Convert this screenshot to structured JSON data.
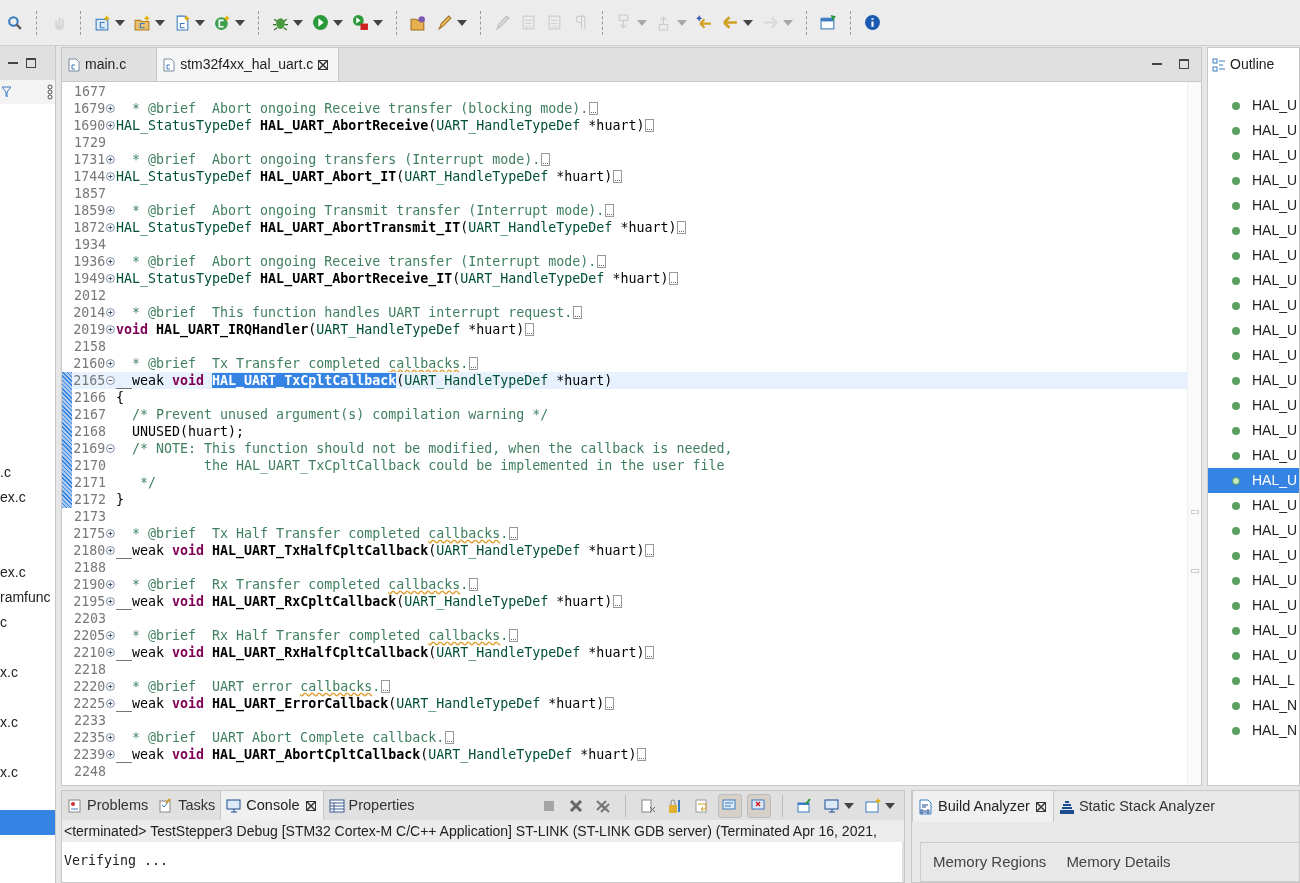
{
  "toolbar": [
    {
      "kind": "search",
      "disabled": false,
      "dropdown": false
    },
    {
      "kind": "separator"
    },
    {
      "kind": "hand",
      "disabled": true,
      "dropdown": false
    },
    {
      "kind": "separator"
    },
    {
      "kind": "new-project",
      "disabled": false,
      "dropdown": true
    },
    {
      "kind": "new-folder",
      "disabled": false,
      "dropdown": true
    },
    {
      "kind": "new-file",
      "disabled": false,
      "dropdown": true
    },
    {
      "kind": "new-class",
      "disabled": false,
      "dropdown": true
    },
    {
      "kind": "separator"
    },
    {
      "kind": "debug",
      "disabled": false,
      "dropdown": true
    },
    {
      "kind": "run",
      "disabled": false,
      "dropdown": true
    },
    {
      "kind": "external-tool",
      "disabled": false,
      "dropdown": true
    },
    {
      "kind": "separator"
    },
    {
      "kind": "open-folder",
      "disabled": false,
      "dropdown": false
    },
    {
      "kind": "pen",
      "disabled": false,
      "dropdown": true
    },
    {
      "kind": "separator"
    },
    {
      "kind": "pen",
      "disabled": true,
      "dropdown": false
    },
    {
      "kind": "document",
      "disabled": true,
      "dropdown": false
    },
    {
      "kind": "document",
      "disabled": true,
      "dropdown": false
    },
    {
      "kind": "pilcrow",
      "disabled": true,
      "dropdown": false
    },
    {
      "kind": "separator"
    },
    {
      "kind": "arrow-down",
      "disabled": true,
      "dropdown": true
    },
    {
      "kind": "arrow-up",
      "disabled": true,
      "dropdown": true
    },
    {
      "kind": "star-arrow",
      "disabled": false,
      "dropdown": false
    },
    {
      "kind": "arrow-left",
      "disabled": false,
      "dropdown": true
    },
    {
      "kind": "arrow-right",
      "disabled": true,
      "dropdown": true
    },
    {
      "kind": "separator"
    },
    {
      "kind": "window",
      "disabled": false,
      "dropdown": false
    },
    {
      "kind": "separator"
    },
    {
      "kind": "info",
      "disabled": false,
      "dropdown": false
    }
  ],
  "project_explorer": {
    "items": [
      {
        "label": ".c",
        "selected": false
      },
      {
        "label": "ex.c",
        "selected": false
      },
      {
        "selected": false
      },
      {
        "selected": false
      },
      {
        "label": "ex.c",
        "selected": false
      },
      {
        "label": "ramfunc",
        "selected": false
      },
      {
        "label": "c",
        "selected": false
      },
      {
        "selected": false
      },
      {
        "label": "x.c",
        "selected": false
      },
      {
        "selected": false
      },
      {
        "label": "x.c",
        "selected": false
      },
      {
        "selected": false
      },
      {
        "label": "x.c",
        "selected": false
      },
      {
        "selected": false
      },
      {
        "selected": true
      }
    ]
  },
  "editor": {
    "tabs": [
      {
        "label": "main.c",
        "selected": false
      },
      {
        "label": "stm32f4xx_hal_uart.c",
        "selected": true
      }
    ],
    "lines": [
      {
        "number": "1677",
        "changed": false,
        "current": false
      },
      {
        "number": "1679",
        "folded": true,
        "changed": false,
        "current": false,
        "tokens": [
          {
            "kind": "comment",
            "text": "  * @brief  Abort ongoing Receive transfer (blocking mode)."
          }
        ]
      },
      {
        "number": "1690",
        "folded": true,
        "changed": false,
        "current": false,
        "tokens": [
          {
            "kind": "type",
            "text": "HAL_StatusTypeDef "
          },
          {
            "kind": "function",
            "text": "HAL_UART_AbortReceive"
          },
          {
            "kind": "plain",
            "text": "("
          },
          {
            "kind": "type",
            "text": "UART_HandleTypeDef"
          },
          {
            "kind": "plain",
            "text": " *huart)"
          }
        ]
      },
      {
        "number": "1729",
        "changed": false,
        "current": false
      },
      {
        "number": "1731",
        "folded": true,
        "changed": false,
        "current": false,
        "tokens": [
          {
            "kind": "comment",
            "text": "  * @brief  Abort ongoing transfers (Interrupt mode)."
          }
        ]
      },
      {
        "number": "1744",
        "folded": true,
        "changed": false,
        "current": false,
        "tokens": [
          {
            "kind": "type",
            "text": "HAL_StatusTypeDef "
          },
          {
            "kind": "function",
            "text": "HAL_UART_Abort_IT"
          },
          {
            "kind": "plain",
            "text": "("
          },
          {
            "kind": "type",
            "text": "UART_HandleTypeDef"
          },
          {
            "kind": "plain",
            "text": " *huart)"
          }
        ]
      },
      {
        "number": "1857",
        "changed": false,
        "current": false
      },
      {
        "number": "1859",
        "folded": true,
        "changed": false,
        "current": false,
        "tokens": [
          {
            "kind": "comment",
            "text": "  * @brief  Abort ongoing Transmit transfer (Interrupt mode)."
          }
        ]
      },
      {
        "number": "1872",
        "folded": true,
        "changed": false,
        "current": false,
        "tokens": [
          {
            "kind": "type",
            "text": "HAL_StatusTypeDef "
          },
          {
            "kind": "function",
            "text": "HAL_UART_AbortTransmit_IT"
          },
          {
            "kind": "plain",
            "text": "("
          },
          {
            "kind": "type",
            "text": "UART_HandleTypeDef"
          },
          {
            "kind": "plain",
            "text": " *huart)"
          }
        ]
      },
      {
        "number": "1934",
        "changed": false,
        "current": false
      },
      {
        "number": "1936",
        "folded": true,
        "changed": false,
        "current": false,
        "tokens": [
          {
            "kind": "comment",
            "text": "  * @brief  Abort ongoing Receive transfer (Interrupt mode)."
          }
        ]
      },
      {
        "number": "1949",
        "folded": true,
        "changed": false,
        "current": false,
        "tokens": [
          {
            "kind": "type",
            "text": "HAL_StatusTypeDef "
          },
          {
            "kind": "function",
            "text": "HAL_UART_AbortReceive_IT"
          },
          {
            "kind": "plain",
            "text": "("
          },
          {
            "kind": "type",
            "text": "UART_HandleTypeDef"
          },
          {
            "kind": "plain",
            "text": " *huart)"
          }
        ]
      },
      {
        "number": "2012",
        "changed": false,
        "current": false
      },
      {
        "number": "2014",
        "folded": true,
        "changed": false,
        "current": false,
        "tokens": [
          {
            "kind": "comment",
            "text": "  * @brief  This function handles UART interrupt request."
          }
        ]
      },
      {
        "number": "2019",
        "folded": true,
        "changed": false,
        "current": false,
        "tokens": [
          {
            "kind": "keyword",
            "text": "void "
          },
          {
            "kind": "function",
            "text": "HAL_UART_IRQHandler"
          },
          {
            "kind": "plain",
            "text": "("
          },
          {
            "kind": "type",
            "text": "UART_HandleTypeDef"
          },
          {
            "kind": "plain",
            "text": " *huart)"
          }
        ]
      },
      {
        "number": "2158",
        "changed": false,
        "current": false
      },
      {
        "number": "2160",
        "folded": true,
        "changed": false,
        "current": false,
        "tokens": [
          {
            "kind": "comment",
            "text": "  * @brief  Tx Transfer completed "
          },
          {
            "kind": "misspelled",
            "text": "callbacks"
          },
          {
            "kind": "comment",
            "text": "."
          }
        ]
      },
      {
        "number": "2165",
        "folded": false,
        "changed": true,
        "current": true,
        "tokens": [
          {
            "kind": "plain",
            "text": "__weak "
          },
          {
            "kind": "keyword",
            "text": "void "
          },
          {
            "kind": "selected_function",
            "text": "HAL_UART_TxCpltCallback"
          },
          {
            "kind": "plain",
            "text": "("
          },
          {
            "kind": "type",
            "text": "UART_HandleTypeDef"
          },
          {
            "kind": "plain",
            "text": " *huart)"
          }
        ]
      },
      {
        "number": "2166",
        "changed": true,
        "current": false,
        "tokens": [
          {
            "kind": "plain",
            "text": "{"
          }
        ]
      },
      {
        "number": "2167",
        "changed": true,
        "current": false,
        "tokens": [
          {
            "kind": "comment",
            "text": "  /* Prevent unused argument(s) compilation warning */"
          }
        ]
      },
      {
        "number": "2168",
        "changed": true,
        "current": false,
        "tokens": [
          {
            "kind": "plain",
            "text": "  UNUSED(huart);"
          }
        ]
      },
      {
        "number": "2169",
        "folded": false,
        "changed": true,
        "current": false,
        "tokens": [
          {
            "kind": "comment",
            "text": "  /* NOTE: This function should not be modified, when the callback is needed,"
          }
        ]
      },
      {
        "number": "2170",
        "changed": true,
        "current": false,
        "tokens": [
          {
            "kind": "comment",
            "text": "           the HAL_UART_TxCpltCallback could be implemented in the user file"
          }
        ]
      },
      {
        "number": "2171",
        "changed": true,
        "current": false,
        "tokens": [
          {
            "kind": "comment",
            "text": "   */"
          }
        ]
      },
      {
        "number": "2172",
        "changed": true,
        "current": false,
        "tokens": [
          {
            "kind": "plain",
            "text": "}"
          }
        ]
      },
      {
        "number": "2173",
        "changed": false,
        "current": false
      },
      {
        "number": "2175",
        "folded": true,
        "changed": false,
        "current": false,
        "tokens": [
          {
            "kind": "comment",
            "text": "  * @brief  Tx Half Transfer completed "
          },
          {
            "kind": "misspelled",
            "text": "callbacks"
          },
          {
            "kind": "comment",
            "text": "."
          }
        ]
      },
      {
        "number": "2180",
        "folded": true,
        "changed": false,
        "current": false,
        "tokens": [
          {
            "kind": "plain",
            "text": "__weak "
          },
          {
            "kind": "keyword",
            "text": "void "
          },
          {
            "kind": "function",
            "text": "HAL_UART_TxHalfCpltCallback"
          },
          {
            "kind": "plain",
            "text": "("
          },
          {
            "kind": "type",
            "text": "UART_HandleTypeDef"
          },
          {
            "kind": "plain",
            "text": " *huart)"
          }
        ]
      },
      {
        "number": "2188",
        "changed": false,
        "current": false
      },
      {
        "number": "2190",
        "folded": true,
        "changed": false,
        "current": false,
        "tokens": [
          {
            "kind": "comment",
            "text": "  * @brief  Rx Transfer completed "
          },
          {
            "kind": "misspelled",
            "text": "callbacks"
          },
          {
            "kind": "comment",
            "text": "."
          }
        ]
      },
      {
        "number": "2195",
        "folded": true,
        "changed": false,
        "current": false,
        "tokens": [
          {
            "kind": "plain",
            "text": "__weak "
          },
          {
            "kind": "keyword",
            "text": "void "
          },
          {
            "kind": "function",
            "text": "HAL_UART_RxCpltCallback"
          },
          {
            "kind": "plain",
            "text": "("
          },
          {
            "kind": "type",
            "text": "UART_HandleTypeDef"
          },
          {
            "kind": "plain",
            "text": " *huart)"
          }
        ]
      },
      {
        "number": "2203",
        "changed": false,
        "current": false
      },
      {
        "number": "2205",
        "folded": true,
        "changed": false,
        "current": false,
        "tokens": [
          {
            "kind": "comment",
            "text": "  * @brief  Rx Half Transfer completed "
          },
          {
            "kind": "misspelled",
            "text": "callbacks"
          },
          {
            "kind": "comment",
            "text": "."
          }
        ]
      },
      {
        "number": "2210",
        "folded": true,
        "changed": false,
        "current": false,
        "tokens": [
          {
            "kind": "plain",
            "text": "__weak "
          },
          {
            "kind": "keyword",
            "text": "void "
          },
          {
            "kind": "function",
            "text": "HAL_UART_RxHalfCpltCallback"
          },
          {
            "kind": "plain",
            "text": "("
          },
          {
            "kind": "type",
            "text": "UART_HandleTypeDef"
          },
          {
            "kind": "plain",
            "text": " *huart)"
          }
        ]
      },
      {
        "number": "2218",
        "changed": false,
        "current": false
      },
      {
        "number": "2220",
        "folded": true,
        "changed": false,
        "current": false,
        "tokens": [
          {
            "kind": "comment",
            "text": "  * @brief  UART error "
          },
          {
            "kind": "misspelled",
            "text": "callbacks"
          },
          {
            "kind": "comment",
            "text": "."
          }
        ]
      },
      {
        "number": "2225",
        "folded": true,
        "changed": false,
        "current": false,
        "tokens": [
          {
            "kind": "plain",
            "text": "__weak "
          },
          {
            "kind": "keyword",
            "text": "void "
          },
          {
            "kind": "function",
            "text": "HAL_UART_ErrorCallback"
          },
          {
            "kind": "plain",
            "text": "("
          },
          {
            "kind": "type",
            "text": "UART_HandleTypeDef"
          },
          {
            "kind": "plain",
            "text": " *huart)"
          }
        ]
      },
      {
        "number": "2233",
        "changed": false,
        "current": false
      },
      {
        "number": "2235",
        "folded": true,
        "changed": false,
        "current": false,
        "tokens": [
          {
            "kind": "comment",
            "text": "  * @brief  UART Abort Complete callback."
          }
        ]
      },
      {
        "number": "2239",
        "folded": true,
        "changed": false,
        "current": false,
        "tokens": [
          {
            "kind": "plain",
            "text": "__weak "
          },
          {
            "kind": "keyword",
            "text": "void "
          },
          {
            "kind": "function",
            "text": "HAL_UART_AbortCpltCallback"
          },
          {
            "kind": "plain",
            "text": "("
          },
          {
            "kind": "type",
            "text": "UART_HandleTypeDef"
          },
          {
            "kind": "plain",
            "text": " *huart)"
          }
        ]
      },
      {
        "number": "2248",
        "changed": false,
        "current": false
      }
    ]
  },
  "outline": {
    "title": "Outline",
    "items": [
      {
        "label": "HAL_U",
        "selected": false
      },
      {
        "label": "HAL_U",
        "selected": false
      },
      {
        "label": "HAL_U",
        "selected": false
      },
      {
        "label": "HAL_U",
        "selected": false
      },
      {
        "label": "HAL_U",
        "selected": false
      },
      {
        "label": "HAL_U",
        "selected": false
      },
      {
        "label": "HAL_U",
        "selected": false
      },
      {
        "label": "HAL_U",
        "selected": false
      },
      {
        "label": "HAL_U",
        "selected": false
      },
      {
        "label": "HAL_U",
        "selected": false
      },
      {
        "label": "HAL_U",
        "selected": false
      },
      {
        "label": "HAL_U",
        "selected": false
      },
      {
        "label": "HAL_U",
        "selected": false
      },
      {
        "label": "HAL_U",
        "selected": false
      },
      {
        "label": "HAL_U",
        "selected": false
      },
      {
        "label": "HAL_U",
        "selected": true
      },
      {
        "label": "HAL_U",
        "selected": false
      },
      {
        "label": "HAL_U",
        "selected": false
      },
      {
        "label": "HAL_U",
        "selected": false
      },
      {
        "label": "HAL_U",
        "selected": false
      },
      {
        "label": "HAL_U",
        "selected": false
      },
      {
        "label": "HAL_U",
        "selected": false
      },
      {
        "label": "HAL_U",
        "selected": false
      },
      {
        "label": "HAL_L",
        "selected": false
      },
      {
        "label": "HAL_N",
        "selected": false
      },
      {
        "label": "HAL_N",
        "selected": false
      }
    ]
  },
  "console": {
    "tabs": [
      {
        "label": "Problems",
        "kind": "problems",
        "selected": false
      },
      {
        "label": "Tasks",
        "kind": "tasks",
        "selected": false
      },
      {
        "label": "Console",
        "kind": "console",
        "selected": true
      },
      {
        "label": "Properties",
        "kind": "properties",
        "selected": false
      }
    ],
    "tools": [
      {
        "kind": "stop",
        "disabled": true,
        "pressed": false,
        "dropdown": false
      },
      {
        "kind": "remove",
        "disabled": false,
        "pressed": false,
        "dropdown": false
      },
      {
        "kind": "remove-all",
        "disabled": false,
        "pressed": false,
        "dropdown": false
      },
      {
        "kind": "separator"
      },
      {
        "kind": "clear",
        "disabled": false,
        "pressed": false,
        "dropdown": false
      },
      {
        "kind": "lock",
        "disabled": false,
        "pressed": false,
        "dropdown": false
      },
      {
        "kind": "wrap",
        "disabled": false,
        "pressed": false,
        "dropdown": false
      },
      {
        "kind": "show-out",
        "disabled": false,
        "pressed": true,
        "dropdown": false
      },
      {
        "kind": "show-err",
        "disabled": false,
        "pressed": true,
        "dropdown": false
      },
      {
        "kind": "separator"
      },
      {
        "kind": "pin",
        "disabled": false,
        "pressed": false,
        "dropdown": false
      },
      {
        "kind": "display",
        "disabled": false,
        "pressed": false,
        "dropdown": true
      },
      {
        "kind": "new-console",
        "disabled": false,
        "pressed": false,
        "dropdown": true
      }
    ],
    "status": "<terminated> TestStepper3 Debug [STM32 Cortex-M C/C++ Application] ST-LINK (ST-LINK GDB server) (Terminated Apr 16, 2021,",
    "output": "Verifying ..."
  },
  "build_analyzer": {
    "tabs": [
      {
        "label": "Build Analyzer",
        "kind": "binary",
        "selected": true
      },
      {
        "label": "Static Stack Analyzer",
        "kind": "stack",
        "selected": false
      }
    ],
    "subtabs": [
      "Memory Regions",
      "Memory Details"
    ]
  }
}
